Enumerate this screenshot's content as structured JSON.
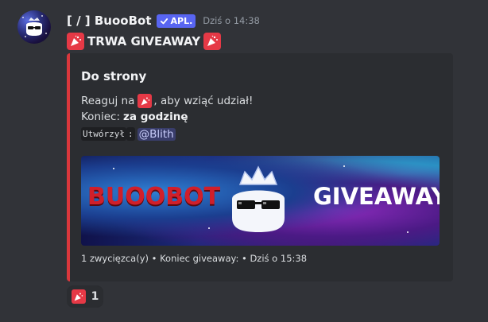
{
  "message": {
    "author": "[ / ] BuooBot",
    "app_badge": "APL.",
    "timestamp": "Dziś o 14:38",
    "content_title": "TRWA GIVEAWAY"
  },
  "embed": {
    "title": "Do strony",
    "line1_prefix": "Reaguj na",
    "line1_suffix": ", aby wziąć udział!",
    "line2_label": "Koniec:",
    "line2_value": "za godzinę",
    "line3_code": "Utwórzył",
    "line3_colon": ":",
    "line3_mention": "@Blith",
    "banner_left": "BUOOBOT",
    "banner_right": "GIVEAWAY",
    "footer": "1 zwycięzca(y) • Koniec giveaway: • Dziś o 15:38",
    "accent_color": "#da373c"
  },
  "reaction": {
    "emoji": "party-popper-icon",
    "count": "1"
  },
  "colors": {
    "background": "#313338",
    "embed_bg": "#2b2d31",
    "badge": "#5865f2"
  }
}
